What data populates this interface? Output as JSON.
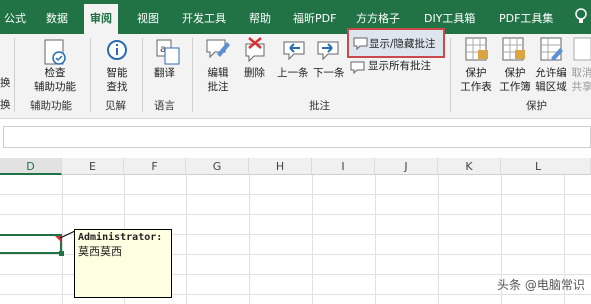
{
  "tabs": [
    "公式",
    "数据",
    "审阅",
    "视图",
    "开发工具",
    "帮助",
    "福昕PDF",
    "方方格子",
    "DIY工具箱",
    "PDF工具集"
  ],
  "active_tab": "审阅",
  "ribbon": {
    "partial_left": [
      "换",
      "换"
    ],
    "check_accessibility": [
      "检查",
      "辅助功能"
    ],
    "accessibility_group": "辅助功能",
    "smart_lookup": [
      "智能",
      "查找"
    ],
    "insights_group": "见解",
    "translate": "翻译",
    "language_group": "语言",
    "edit_comment": [
      "编辑",
      "批注"
    ],
    "delete": "删除",
    "previous": "上一条",
    "next": "下一条",
    "show_hide_comment": "显示/隐藏批注",
    "show_all_comments": "显示所有批注",
    "comments_group": "批注",
    "protect_sheet": [
      "保护",
      "工作表"
    ],
    "protect_workbook": [
      "保护",
      "工作簿"
    ],
    "allow_edit_ranges": [
      "允许编",
      "辑区域"
    ],
    "cancel_share": [
      "取消",
      "共享"
    ],
    "protect_group": "保护"
  },
  "columns": [
    "D",
    "E",
    "F",
    "G",
    "H",
    "I",
    "J",
    "K",
    "L"
  ],
  "comment": {
    "author": "Administrator:",
    "text": "莫西莫西"
  },
  "watermark": "头条 @电脑常识"
}
